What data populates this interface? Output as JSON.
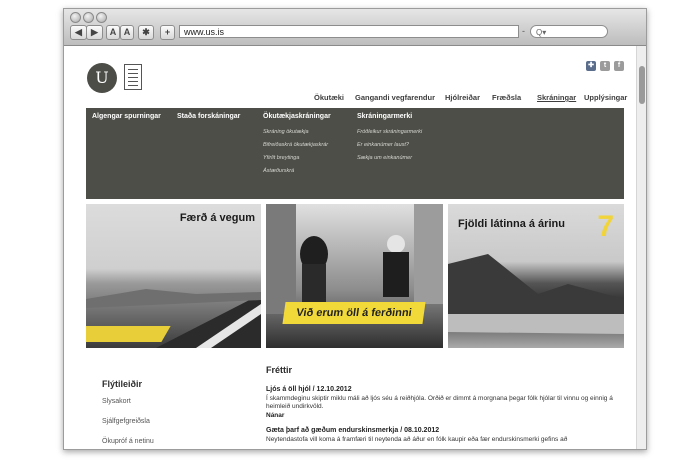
{
  "browser": {
    "text_size_small": "A",
    "text_size_large": "A",
    "add_button": "+",
    "url": "www.us.is",
    "search_placeholder": "Q▾"
  },
  "header": {
    "logo_letter": "U",
    "social": [
      "flag-uk-icon",
      "twitter-icon",
      "facebook-icon"
    ],
    "nav": [
      "Ökutæki",
      "Gangandi vegfarendur",
      "Hjólreiðar",
      "Fræðsla",
      "Skráningar",
      "Upplýsingar"
    ]
  },
  "mega": {
    "col1": {
      "heading": "Algengar spurningar"
    },
    "col2": {
      "heading": "Staða forskáningar"
    },
    "col3": {
      "heading": "Ökutækjaskráningar",
      "items": [
        "Skráning ökutækja",
        "Bifreiðaskrá ökutækjaskrár",
        "Yfirlit breytinga",
        "Ástæðurskrá"
      ]
    },
    "col4": {
      "heading": "Skráningarmerki",
      "items": [
        "Fróðleikur skráningarmerki",
        "Er einkanúmer laust?",
        "Sækja um einkanúmer"
      ]
    }
  },
  "banners": {
    "b1": {
      "title": "Færð á vegum"
    },
    "b2": {
      "caption": "Við erum öll á ferðinni"
    },
    "b3": {
      "title": "Fjöldi látinna á árinu",
      "number": "7"
    }
  },
  "sidebar": {
    "title": "Flýtileiðir",
    "links": [
      "Slysakort",
      "Sjálfgefgreiðsla",
      "Ökupróf á netinu"
    ]
  },
  "news": {
    "heading": "Fréttir",
    "items": [
      {
        "title": "Ljós á öll hjól / 12.10.2012",
        "body": "Í skammdeginu skiptir miklu máli að ljós séu á reiðhjóla. Orðið er dimmt á morgnana þegar fólk hjólar til vinnu og einnig á heimleið undirkvöld.",
        "more": "Nánar"
      },
      {
        "title": "Gæta þarf að gæðum endurskinsmerkja / 08.10.2012",
        "body": "Neytendastofa vill koma á framfæri til neytenda að áður en fólk kaupir eða fær endurskinsmerki gefins að"
      }
    ]
  }
}
